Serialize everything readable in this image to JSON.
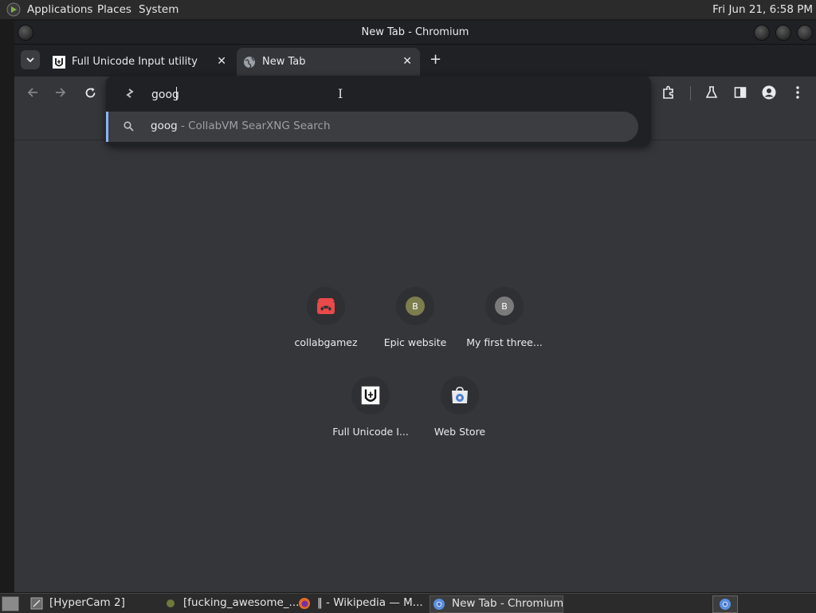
{
  "top_panel": {
    "menus": [
      "Applications",
      "Places",
      "System"
    ],
    "clock": "Fri Jun 21,  6:58 PM"
  },
  "window": {
    "title": "New Tab - Chromium"
  },
  "tabs": [
    {
      "title": "Full Unicode Input utility",
      "favicon": "unicode-u-icon",
      "active": false
    },
    {
      "title": "New Tab",
      "favicon": "globe-icon",
      "active": true
    }
  ],
  "omnibox": {
    "value": "goog",
    "suggestion": {
      "query": "goog",
      "description": " - CollabVM SearXNG Search",
      "icon": "search-icon"
    }
  },
  "shortcuts": [
    {
      "label": "collabgamez",
      "icon": "game-controller-icon"
    },
    {
      "label": "Epic website",
      "letter": "B",
      "color": "#7d7d4e"
    },
    {
      "label": "My first three...",
      "letter": "B",
      "color": "#7a7a7a"
    },
    {
      "label": "Full Unicode I...",
      "icon": "unicode-u-icon"
    },
    {
      "label": "Web Store",
      "icon": "web-store-icon"
    }
  ],
  "taskbar": {
    "items": [
      {
        "label": "[HyperCam 2]",
        "icon": "hypercam-icon"
      },
      {
        "label": "[fucking_awesome_...",
        "icon": "app-dot-icon"
      },
      {
        "label": "‖ - Wikipedia — M...",
        "icon": "firefox-icon"
      },
      {
        "label": "New Tab - Chromium",
        "icon": "chromium-icon",
        "active": true
      }
    ]
  },
  "colors": {
    "accent": "#8ab4f8",
    "frame": "#202124",
    "page_bg": "#35363a",
    "omnibox_bg": "#202124"
  }
}
